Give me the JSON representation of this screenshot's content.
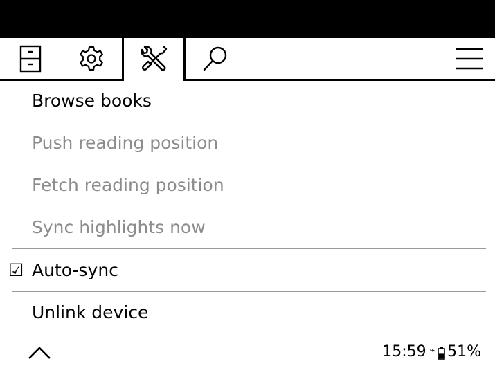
{
  "tabs": [
    {
      "name": "file-browser",
      "icon": "file-cabinet-icon"
    },
    {
      "name": "settings",
      "icon": "gear-icon"
    },
    {
      "name": "tools",
      "icon": "tools-icon",
      "active": true
    },
    {
      "name": "search",
      "icon": "search-icon"
    },
    {
      "name": "main-menu",
      "icon": "hamburger-menu-icon"
    }
  ],
  "menu": {
    "browse_books": "Browse books",
    "push_reading_position": "Push reading position",
    "fetch_reading_position": "Fetch reading position",
    "sync_highlights_now": "Sync highlights now",
    "auto_sync_check": "☑",
    "auto_sync": "Auto-sync",
    "unlink_device": "Unlink device"
  },
  "footer": {
    "back_icon": "chevron-up-icon",
    "time": "15:59",
    "wifi_glyph": "⌁",
    "battery_level": 0.51,
    "battery_percent": "51%"
  },
  "colors": {
    "disabled_text": "#8c8c8c",
    "separator": "#9a9a9a",
    "top_bar": "#000000"
  }
}
